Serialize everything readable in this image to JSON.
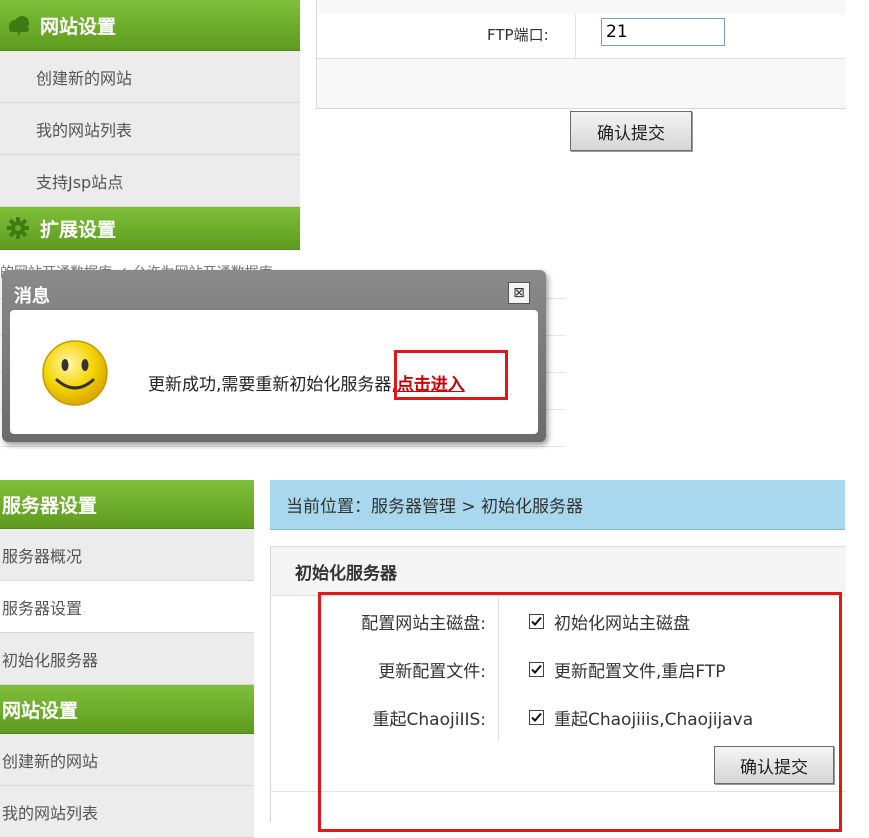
{
  "panel1": {
    "sidebar": {
      "header1": "网站设置",
      "items": [
        "创建新的网站",
        "我的网站列表",
        "支持Jsp站点"
      ],
      "header2": "扩展设置"
    },
    "form": {
      "ftp_port_label": "FTP端口:",
      "ftp_port_value": "21",
      "submit_label": "确认提交"
    }
  },
  "panel2": {
    "background_text": "的网站开通数据库  ✓  允许为网站开通数据库",
    "dialog": {
      "title": "消息",
      "close_glyph": "⊠",
      "message": "更新成功,需要重新初始化服务器,",
      "link": "点击进入"
    }
  },
  "panel3": {
    "sidebar": {
      "header1": "服务器设置",
      "items": [
        "服务器概况",
        "服务器设置",
        "初始化服务器"
      ],
      "header2": "网站设置",
      "items2": [
        "创建新的网站",
        "我的网站列表"
      ]
    },
    "breadcrumb": "当前位置：服务器管理 > 初始化服务器",
    "panel_title": "初始化服务器",
    "rows": [
      {
        "label": "配置网站主磁盘:",
        "value": "初始化网站主磁盘",
        "checked": true
      },
      {
        "label": "更新配置文件:",
        "value": "更新配置文件,重启FTP",
        "checked": true
      },
      {
        "label": "重起ChaojiIIS:",
        "value": "重起Chaojiiis,Chaojijava",
        "checked": true
      }
    ],
    "submit_label": "确认提交"
  },
  "colors": {
    "sidebar_green": "#6aa82a",
    "breadcrumb_blue": "#a9d8ee",
    "highlight_red": "#e01818",
    "link_red": "#cc0000"
  }
}
